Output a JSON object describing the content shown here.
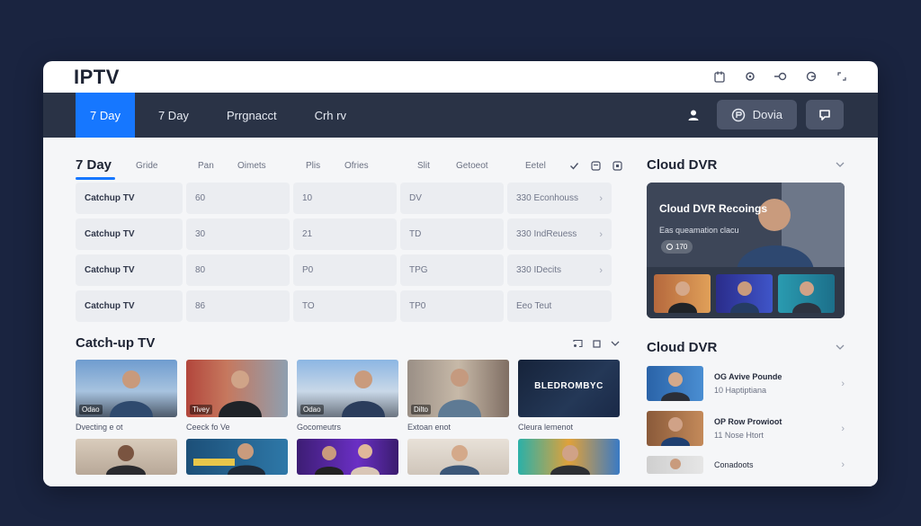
{
  "app": {
    "title": "IPTV"
  },
  "nav": {
    "tabs": [
      {
        "label": "7 Day",
        "active": true
      },
      {
        "label": "7 Day"
      },
      {
        "label": "Prrgnacct"
      },
      {
        "label": "Crh rv"
      }
    ],
    "device_label": "Dovia"
  },
  "schedule": {
    "title": "7 Day",
    "columns": [
      "Gride",
      "Pan",
      "Oimets",
      "Plis",
      "Ofries",
      "Slit",
      "Getoeot",
      "Eetel"
    ],
    "rows": [
      [
        "Catchup TV",
        "60",
        "10",
        "DV",
        "330 Econhouss"
      ],
      [
        "Catchup TV",
        "30",
        "21",
        "TD",
        "330 IndReuess"
      ],
      [
        "Catchup TV",
        "80",
        "P0",
        "TPG",
        "330 IDecits"
      ],
      [
        "Catchup TV",
        "86",
        "TO",
        "TP0",
        "Eeo Teut"
      ]
    ]
  },
  "catchup": {
    "title": "Catch-up TV",
    "row1": [
      {
        "caption": "Dvecting e ot",
        "badge": "Odao"
      },
      {
        "caption": "Ceeck fo Ve",
        "badge": "Tivey"
      },
      {
        "caption": "Gocomeutrs",
        "badge": "Odao"
      },
      {
        "caption": "Extoan enot",
        "badge": "Dilto"
      },
      {
        "caption": "Cleura lemenot",
        "brand": "BLEDROMBYC"
      }
    ]
  },
  "cloud_dvr_top": {
    "title": "Cloud DVR",
    "hero_title": "Cloud DVR Recoings",
    "hero_sub": "Eas queamation clacu",
    "hero_btn": "170"
  },
  "cloud_dvr_bottom": {
    "title": "Cloud DVR",
    "items": [
      {
        "title": "OG Avive Pounde",
        "sub": "10 Haptiptiana"
      },
      {
        "title": "OP Row Prowioot",
        "sub": "11 Nose Htort"
      },
      {
        "title": "Conadoots",
        "sub": ""
      }
    ]
  },
  "colors": {
    "accent": "#1677ff",
    "nav_bg": "#2a3346",
    "page_bg": "#1a2440"
  }
}
